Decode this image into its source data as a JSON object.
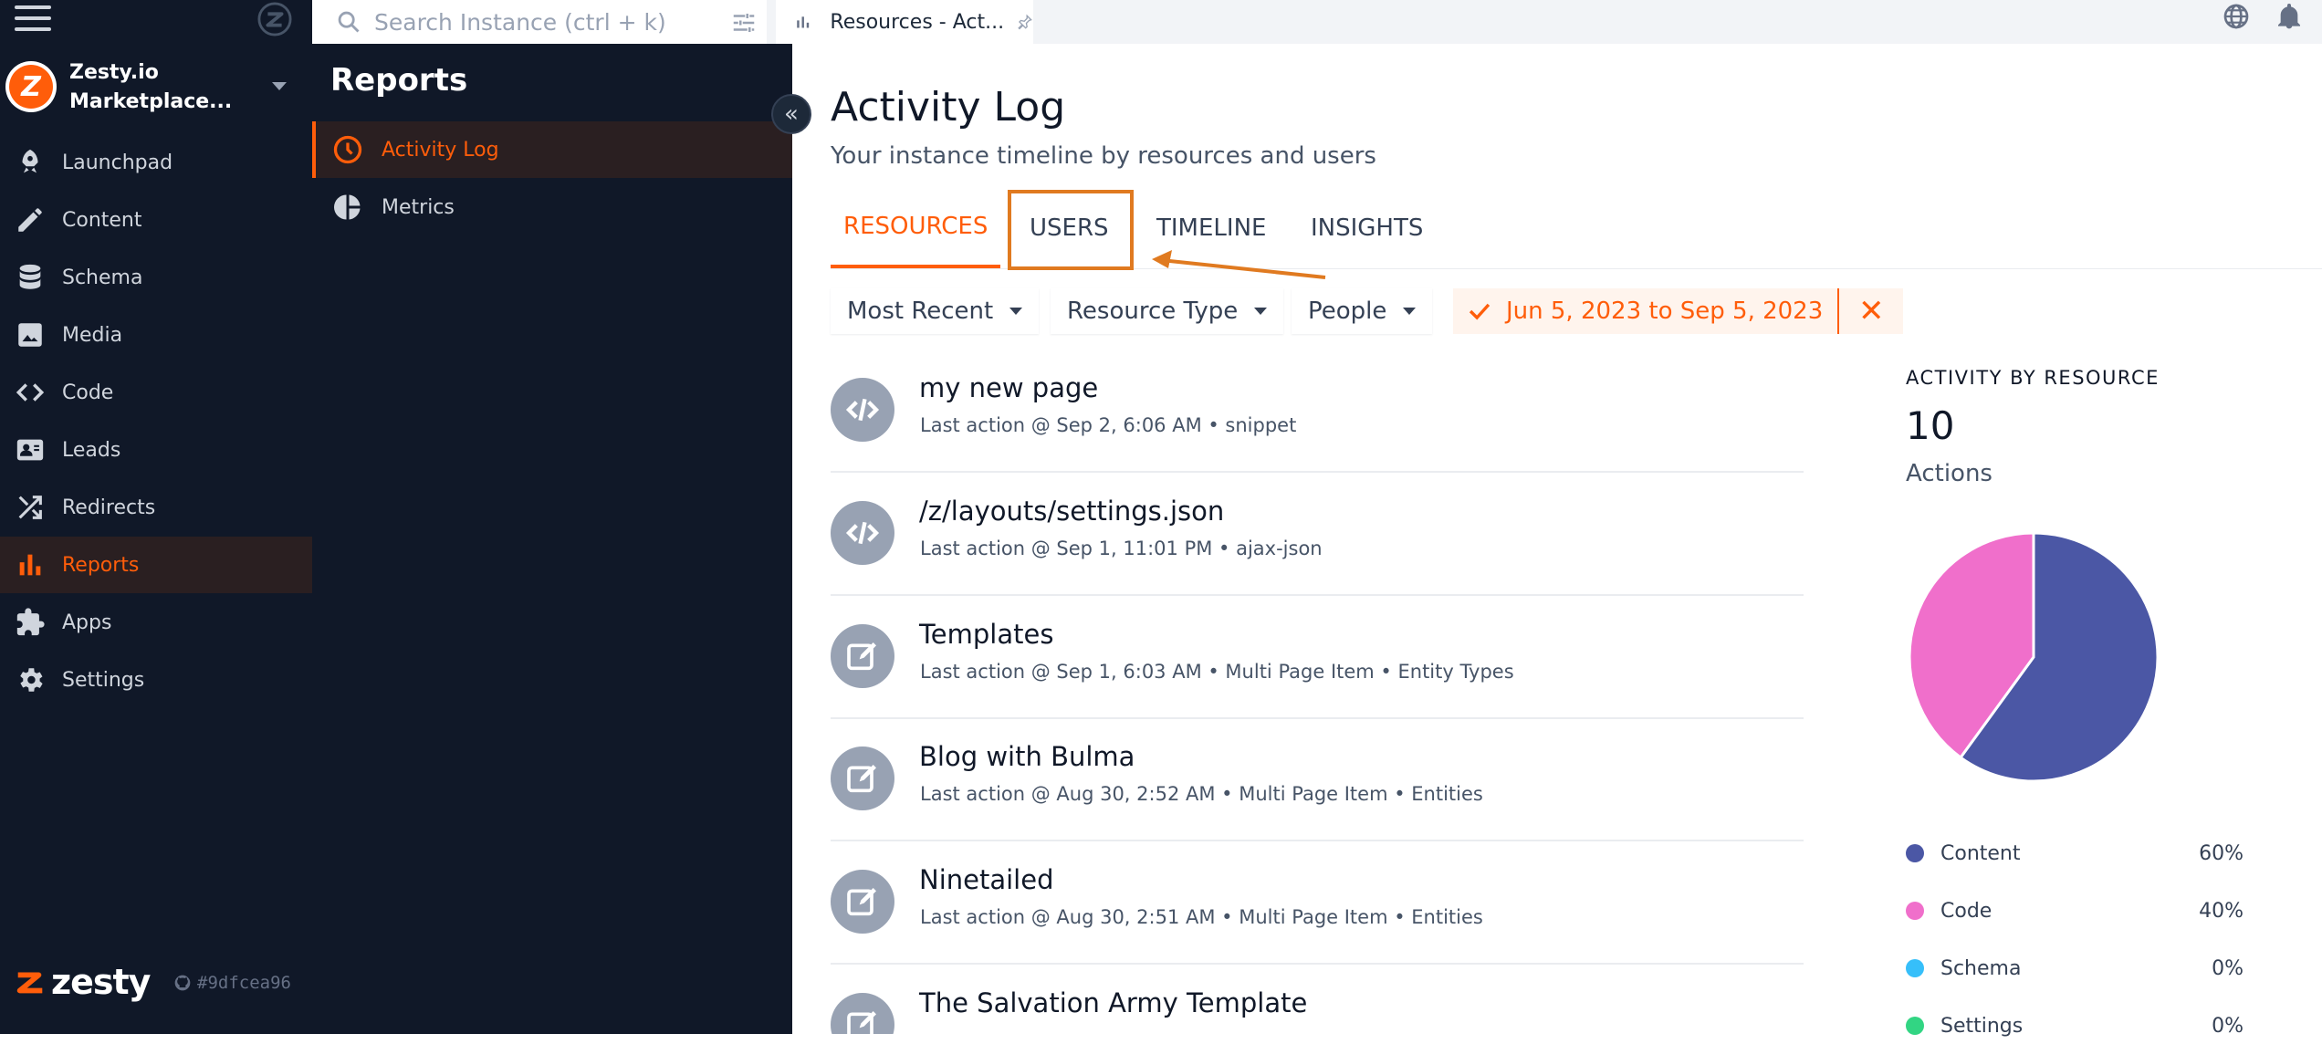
{
  "nav": {
    "instance_name": "Zesty.io Marketplace...",
    "items": [
      {
        "label": "Launchpad",
        "icon": "rocket-icon"
      },
      {
        "label": "Content",
        "icon": "pencil-icon"
      },
      {
        "label": "Schema",
        "icon": "database-icon"
      },
      {
        "label": "Media",
        "icon": "image-icon"
      },
      {
        "label": "Code",
        "icon": "code-icon"
      },
      {
        "label": "Leads",
        "icon": "contact-card-icon"
      },
      {
        "label": "Redirects",
        "icon": "shuffle-icon"
      },
      {
        "label": "Reports",
        "icon": "bar-chart-icon",
        "active": true
      },
      {
        "label": "Apps",
        "icon": "puzzle-icon"
      },
      {
        "label": "Settings",
        "icon": "gear-icon"
      }
    ],
    "footer_brand": "zesty",
    "footer_hash": "#9dfcea96"
  },
  "search": {
    "placeholder": "Search Instance (ctrl + k)"
  },
  "subnav": {
    "title": "Reports",
    "items": [
      {
        "label": "Activity Log",
        "icon": "clock-icon",
        "active": true
      },
      {
        "label": "Metrics",
        "icon": "pie-chart-icon"
      }
    ]
  },
  "topbar": {
    "tab_label": "Resources - Act..."
  },
  "main": {
    "title": "Activity Log",
    "subtitle": "Your instance timeline by resources and users",
    "tabs": [
      {
        "label": "RESOURCES",
        "active": true
      },
      {
        "label": "USERS"
      },
      {
        "label": "TIMELINE"
      },
      {
        "label": "INSIGHTS"
      }
    ],
    "filters": {
      "sort": "Most Recent",
      "resource_type": "Resource Type",
      "people": "People",
      "date_range": "Jun 5, 2023 to Sep 5, 2023"
    },
    "rows": [
      {
        "title": "my new page",
        "meta": "Last action @ Sep 2, 6:06 AM • snippet",
        "icon": "code-icon"
      },
      {
        "title": "/z/layouts/settings.json",
        "meta": "Last action @ Sep 1, 11:01 PM • ajax-json",
        "icon": "code-icon"
      },
      {
        "title": "Templates",
        "meta": "Last action @ Sep 1, 6:03 AM • Multi Page Item • Entity Types",
        "icon": "edit-icon"
      },
      {
        "title": "Blog with Bulma",
        "meta": "Last action @ Aug 30, 2:52 AM • Multi Page Item • Entities",
        "icon": "edit-icon"
      },
      {
        "title": "Ninetailed",
        "meta": "Last action @ Aug 30, 2:51 AM • Multi Page Item • Entities",
        "icon": "edit-icon"
      },
      {
        "title": "The Salvation Army Template",
        "meta": "",
        "icon": "edit-icon"
      }
    ]
  },
  "stats": {
    "heading": "ACTIVITY BY RESOURCE",
    "count": "10",
    "unit": "Actions",
    "legend": [
      {
        "label": "Content",
        "pct": "60%",
        "color": "#4b57a5"
      },
      {
        "label": "Code",
        "pct": "40%",
        "color": "#f06fcb"
      },
      {
        "label": "Schema",
        "pct": "0%",
        "color": "#36bffa"
      },
      {
        "label": "Settings",
        "pct": "0%",
        "color": "#32d583"
      }
    ]
  },
  "chart_data": {
    "type": "pie",
    "title": "ACTIVITY BY RESOURCE",
    "categories": [
      "Content",
      "Code",
      "Schema",
      "Settings"
    ],
    "values": [
      60,
      40,
      0,
      0
    ],
    "colors": [
      "#4b57a5",
      "#f06fcb",
      "#36bffa",
      "#32d583"
    ]
  },
  "colors": {
    "accent": "#ff5d0a",
    "nav_bg": "#101828",
    "annotation": "#e07a20"
  }
}
